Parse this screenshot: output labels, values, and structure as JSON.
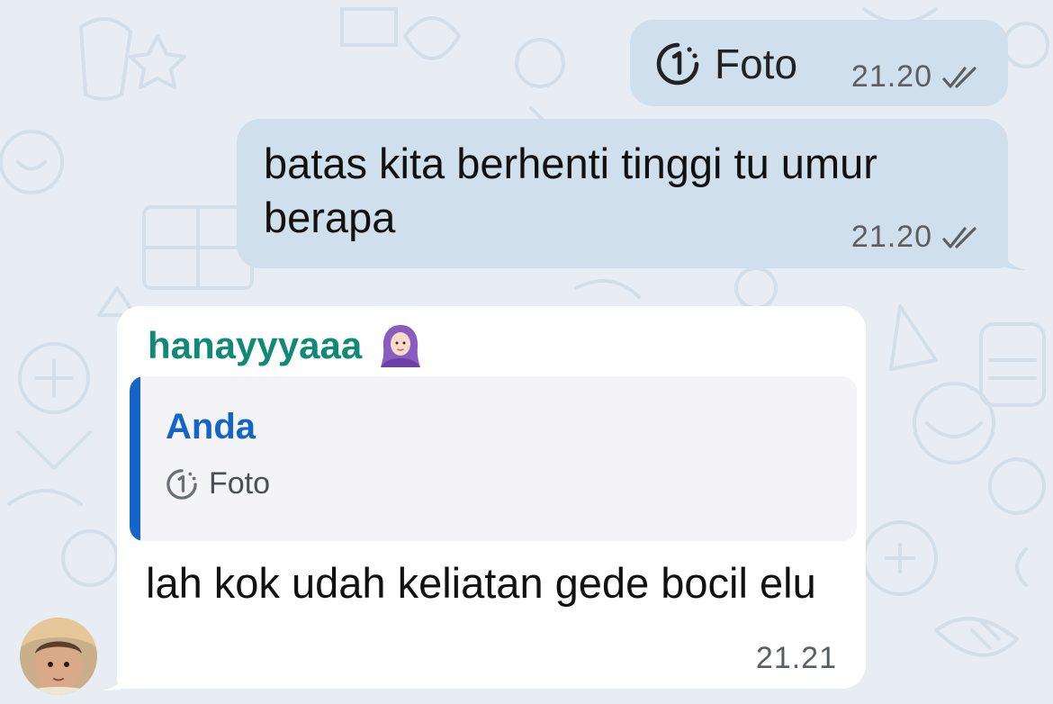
{
  "colors": {
    "background": "#e7edf3",
    "outgoing_bubble": "#d0dfec",
    "incoming_bubble": "#ffffff",
    "sender_name": "#108a76",
    "quote_accent": "#1565c8"
  },
  "messages": [
    {
      "direction": "outgoing",
      "type": "view-once-photo",
      "label": "Foto",
      "time": "21.20",
      "status": "read",
      "icon": "view-once-icon"
    },
    {
      "direction": "outgoing",
      "type": "text",
      "text": "batas kita berhenti tinggi tu umur berapa",
      "time": "21.20",
      "status": "read"
    },
    {
      "direction": "incoming",
      "type": "reply",
      "sender": "hanayyyaaa",
      "sender_emoji_icon": "woman-with-headscarf-icon",
      "quoted": {
        "author": "Anda",
        "label": "Foto",
        "icon": "view-once-icon"
      },
      "text": "lah kok udah keliatan gede bocil elu",
      "time": "21.21"
    }
  ]
}
